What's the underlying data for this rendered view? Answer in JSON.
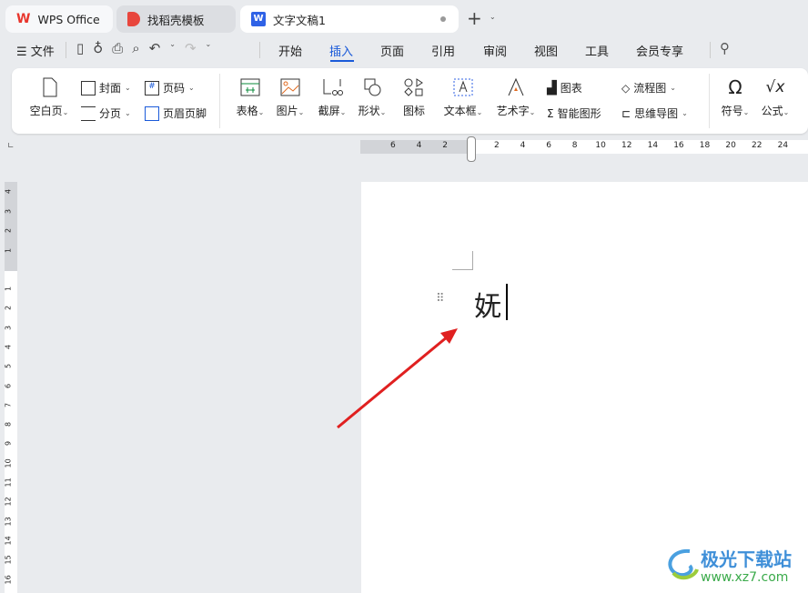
{
  "tabs": [
    {
      "label": "WPS Office"
    },
    {
      "label": "找稻壳模板"
    },
    {
      "label": "文字文稿1"
    }
  ],
  "menu": {
    "file": "文件",
    "items": [
      "开始",
      "插入",
      "页面",
      "引用",
      "审阅",
      "视图",
      "工具",
      "会员专享"
    ],
    "active": "插入"
  },
  "ribbon": {
    "blank_page": "空白页",
    "cover": "封面",
    "page_number": "页码",
    "page_break": "分页",
    "header_footer": "页眉页脚",
    "table": "表格",
    "picture": "图片",
    "screenshot": "截屏",
    "shape": "形状",
    "icon": "图标",
    "textbox": "文本框",
    "wordart": "艺术字",
    "chart": "图表",
    "smart_art": "智能图形",
    "flowchart": "流程图",
    "mindmap": "思维导图",
    "symbol": "符号",
    "formula": "公式"
  },
  "ruler": {
    "h_left": [
      "6",
      "4",
      "2"
    ],
    "h_right": [
      "2",
      "4",
      "6",
      "8",
      "10",
      "12",
      "14",
      "16",
      "18",
      "20",
      "22",
      "24"
    ],
    "v_top": [
      "4",
      "3",
      "2",
      "1"
    ],
    "v_main": [
      "1",
      "2",
      "3",
      "4",
      "5",
      "6",
      "7",
      "8",
      "9",
      "10",
      "11",
      "12",
      "13",
      "14",
      "15",
      "16"
    ]
  },
  "document": {
    "text": "妩"
  },
  "watermark": {
    "name": "极光下载站",
    "url": "www.xz7.com"
  },
  "colors": {
    "accent": "#1a5ad9",
    "arrow": "#e02020",
    "wps_red": "#e8362d"
  }
}
